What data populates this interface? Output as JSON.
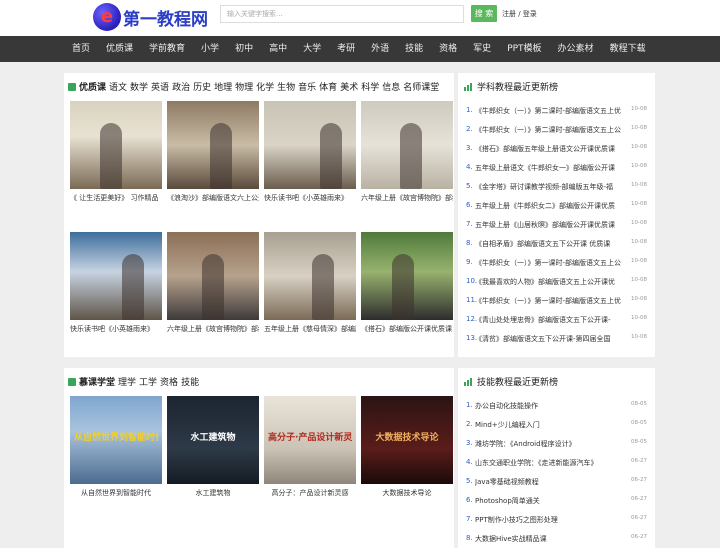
{
  "site": {
    "logo_glyph": "e",
    "logo_text": "第一教程网"
  },
  "search": {
    "placeholder": "输入关键字搜索...",
    "button": "搜 索",
    "login": "注册 / 登录"
  },
  "nav": [
    "首页",
    "优质课",
    "学前教育",
    "小学",
    "初中",
    "高中",
    "大学",
    "考研",
    "外语",
    "技能",
    "资格",
    "军史",
    "PPT模板",
    "办公素材",
    "教程下载"
  ],
  "section1": {
    "title": "优质课",
    "tags": [
      "语文",
      "数学",
      "英语",
      "政治",
      "历史",
      "地理",
      "物理",
      "化学",
      "生物",
      "音乐",
      "体育",
      "美术",
      "科学",
      "信息",
      "名师课堂"
    ],
    "items": [
      {
        "caption": "《 让生活更美好》 习作精品",
        "icon": "classroom-teacher-image"
      },
      {
        "caption": "《浪淘沙》部编版语文六上公开课",
        "icon": "classroom-students-image"
      },
      {
        "caption": "快乐读书吧《小英雄雨来》",
        "icon": "classroom-girl-image"
      },
      {
        "caption": "六年级上册《故宫博物院》部编版",
        "icon": "classroom-teacher-board-image"
      },
      {
        "caption": "快乐读书吧《小英雄雨来》",
        "icon": "classroom-projector-image"
      },
      {
        "caption": "六年级上册《故宫博物院》部编版",
        "icon": "classroom-students-image"
      },
      {
        "caption": "五年级上册《慈母情深》部编版",
        "icon": "classroom-girls-image"
      },
      {
        "caption": "《搭石》部编版公开课优质课",
        "icon": "teacher-green-board-image"
      }
    ]
  },
  "rank1": {
    "title": "学科教程最近更新榜",
    "items": [
      {
        "n": "1.",
        "t": "《牛郎织女（一）》第二课时-部编版语文五上优",
        "d": "10-08"
      },
      {
        "n": "2.",
        "t": "《牛郎织女（一）》第二课时-部编版语文五上公",
        "d": "10-08"
      },
      {
        "n": "3.",
        "t": "《搭石》部编版五年级上册语文公开课优质课",
        "d": "10-08"
      },
      {
        "n": "4.",
        "t": "五年级上册语文《牛郎织女一》部编版公开课",
        "d": "10-08"
      },
      {
        "n": "5.",
        "t": "《金字塔》研讨课教学视频-部编版五年级-福",
        "d": "10-08"
      },
      {
        "n": "6.",
        "t": "五年级上册《牛郎织女二》部编版公开课优质",
        "d": "10-08"
      },
      {
        "n": "7.",
        "t": "五年级上册《山居秋暝》部编版公开课优质课",
        "d": "10-08"
      },
      {
        "n": "8.",
        "t": "《自相矛盾》部编版语文五下公开课 优质课",
        "d": "10-08"
      },
      {
        "n": "9.",
        "t": "《牛郎织女（一）》第一课时-部编版语文五上公",
        "d": "10-08"
      },
      {
        "n": "10.",
        "t": "《我最喜欢的人物》部编版语文五上公开课优",
        "d": "10-08"
      },
      {
        "n": "11.",
        "t": "《牛郎织女（一）》第一课时-部编版语文五上优",
        "d": "10-08"
      },
      {
        "n": "12.",
        "t": "《青山处处埋忠骨》部编版语文五下公开课-",
        "d": "10-08"
      },
      {
        "n": "13.",
        "t": "《清贫》部编版语文五下公开课-第四届全国",
        "d": "10-08"
      }
    ]
  },
  "section2": {
    "title": "慕课学堂",
    "tags": [
      "理学",
      "工学",
      "资格",
      "技能"
    ],
    "items": [
      {
        "caption": "从自然世界到智能时代",
        "overlay": "从自然世界到智能时代",
        "icon": "city-skyline-image"
      },
      {
        "caption": "水工建筑物",
        "overlay": "水工建筑物",
        "icon": "dark-cover-image"
      },
      {
        "caption": "高分子：产品设计新灵感",
        "overlay": "高分子·产品设计新灵感",
        "icon": "light-cover-image"
      },
      {
        "caption": "大数据技术导论",
        "overlay": "大数据技术导论",
        "icon": "red-cover-image"
      }
    ]
  },
  "rank2": {
    "title": "技能教程最近更新榜",
    "items": [
      {
        "n": "1.",
        "t": "办公自动化技能操作",
        "d": "08-05"
      },
      {
        "n": "2.",
        "t": "Mind+少儿编程入门",
        "d": "08-05"
      },
      {
        "n": "3.",
        "t": "潍坊学院：《Android程序设计》",
        "d": "08-05"
      },
      {
        "n": "4.",
        "t": "山东交通职业学院：《走进新能源汽车》",
        "d": "06-27"
      },
      {
        "n": "5.",
        "t": "Java零基础视频教程",
        "d": "06-27"
      },
      {
        "n": "6.",
        "t": "Photoshop简单通关",
        "d": "06-27"
      },
      {
        "n": "7.",
        "t": "PPT制作小技巧之图形处理",
        "d": "06-27"
      },
      {
        "n": "8.",
        "t": "大数据Hive实战精品课",
        "d": "06-27"
      }
    ]
  },
  "colors": {
    "accent": "#5cb85c",
    "nav_bg": "#383838",
    "link": "#2a62c9"
  }
}
